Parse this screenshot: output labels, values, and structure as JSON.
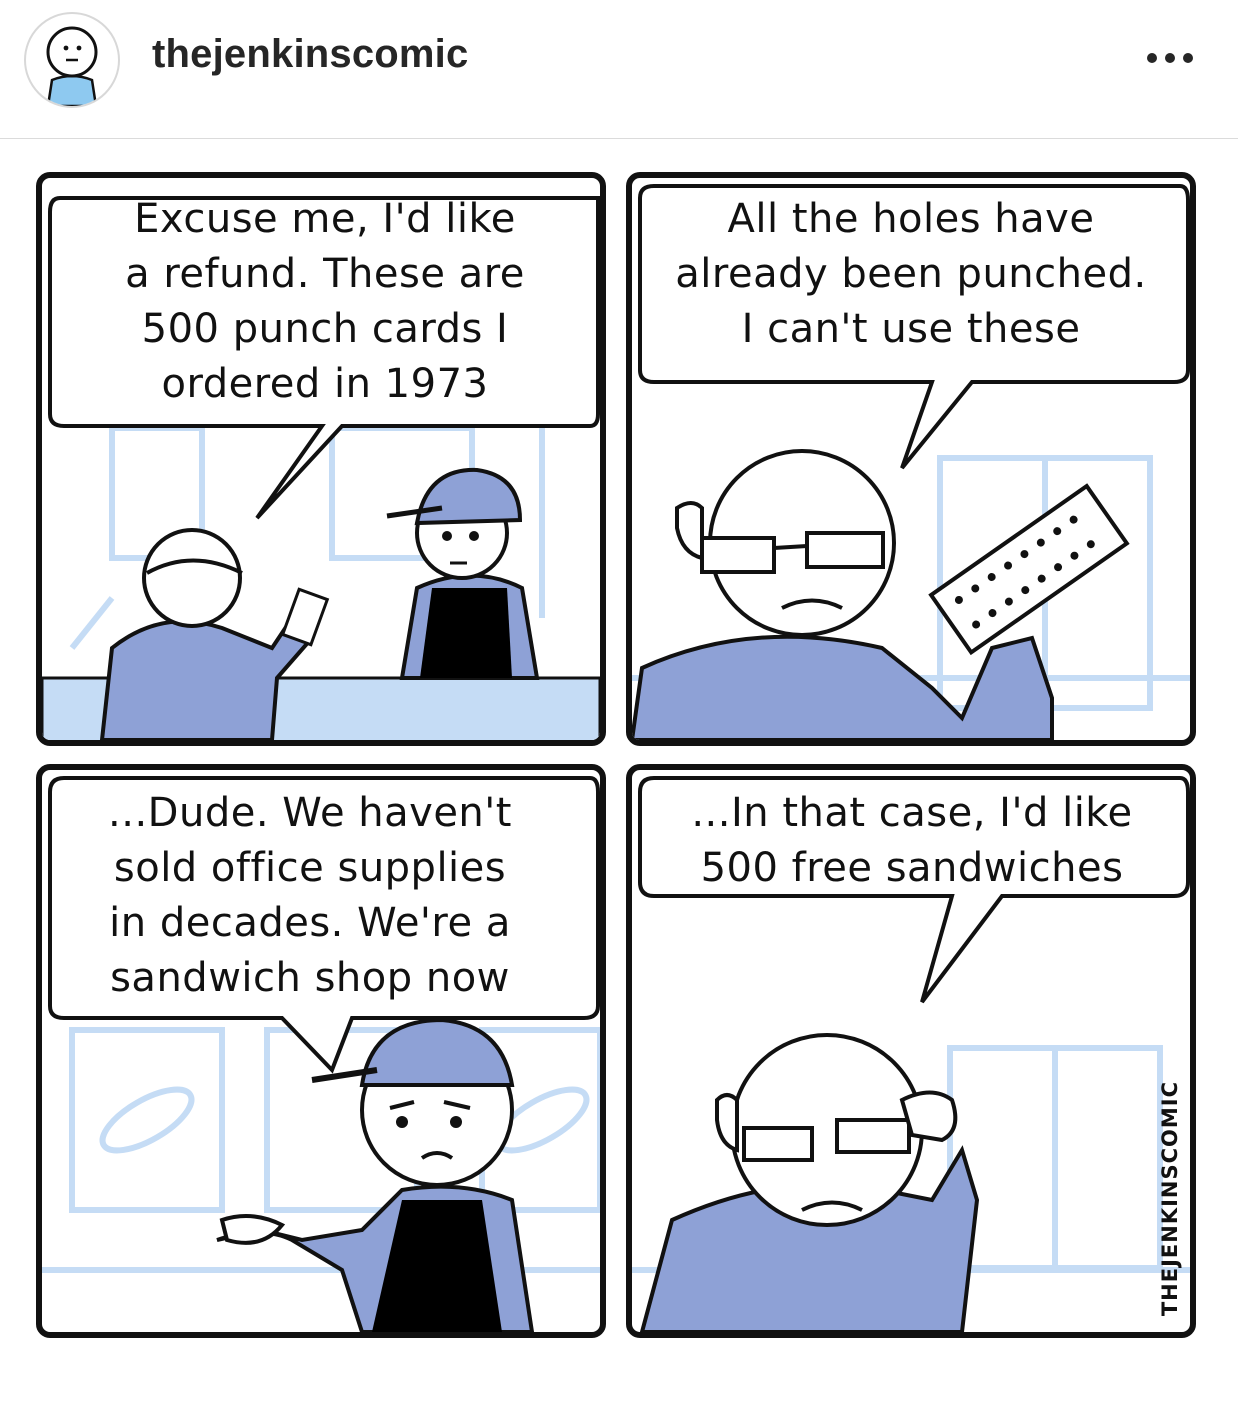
{
  "header": {
    "username": "thejenkinscomic",
    "more_icon": "more-horizontal-icon",
    "avatar_icon": "stick-figure-avatar"
  },
  "comic": {
    "panels": [
      {
        "text": "Excuse me, I'd like\na refund. These are\n500 punch cards I\nordered in 1973"
      },
      {
        "text": "All the holes have\nalready been punched.\nI can't use these"
      },
      {
        "text": "...Dude. We haven't\nsold office supplies\nin decades. We're a\nsandwich shop now"
      },
      {
        "text": "...In that case, I'd like\n500 free sandwiches"
      }
    ],
    "watermark": "THEJENKINSCOMIC"
  },
  "colors": {
    "line": "#111111",
    "pale_blue": "#c5dcf5",
    "shirt_blue": "#7f93d0",
    "skin": "#ffffff",
    "apron": "#000000"
  }
}
